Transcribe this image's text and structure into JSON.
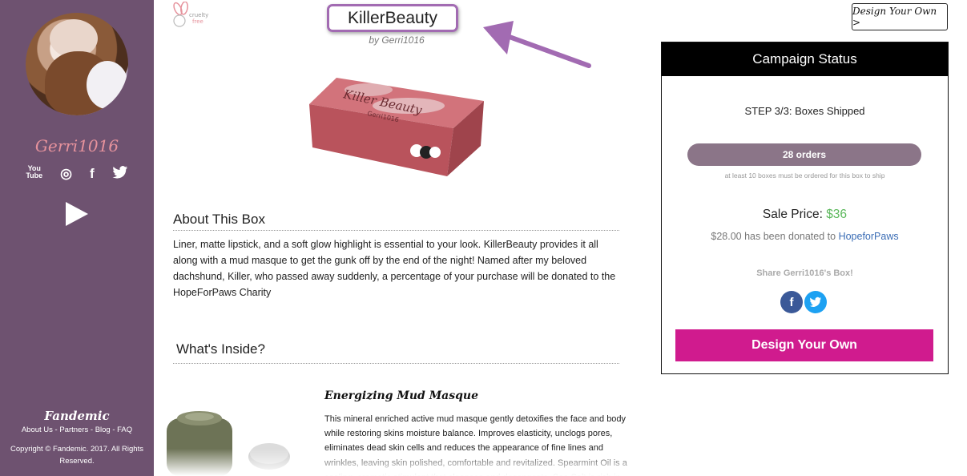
{
  "sidebar": {
    "username": "Gerri1016",
    "social_icons": [
      "youtube-icon",
      "instagram-icon",
      "facebook-icon",
      "twitter-icon"
    ],
    "social_glyphs": [
      "You\nTube",
      "◎",
      "f",
      "🐦"
    ],
    "brand": "Fandemic",
    "footer_links": "About Us - Partners - Blog - FAQ",
    "copyright": "Copyright © Fandemic. 2017. All Rights Reserved."
  },
  "header": {
    "cruelty_free": "cruelty free",
    "title": "KillerBeauty",
    "byline": "by Gerri1016",
    "design_own_top": "Design Your Own >"
  },
  "box_image": {
    "lid_text": "Killer Beauty",
    "side_text": "Gerri1016"
  },
  "about": {
    "heading": "About This Box",
    "text": "Liner, matte lipstick, and a soft glow highlight is essential to your look. KillerBeauty provides it all along with a mud masque to get the gunk off by the end of the night! Named after my beloved dachshund, Killer, who passed away suddenly, a percentage of your purchase will be donated to the HopeForPaws Charity"
  },
  "inside": {
    "heading": "What's Inside?",
    "product_name": "Energizing Mud Masque",
    "product_desc": "This mineral enriched active mud masque gently detoxifies the face and body while restoring skins moisture balance. Improves elasticity, unclogs pores, eliminates dead skin cells and reduces the appearance of fine lines and wrinkles, leaving skin polished, comfortable and revitalized. Spearmint Oil is a cooling, aromatic stimulant that cleanses and decongests. Sea Salt is rich in"
  },
  "campaign": {
    "heading": "Campaign Status",
    "step": "STEP 3/3: Boxes Shipped",
    "orders": "28 orders",
    "min_note": "at least 10 boxes must be ordered for this box to ship",
    "sale_label": "Sale Price:",
    "sale_price": "$36",
    "donated_prefix": "$28.00 has been donated to",
    "charity": "HopeforPaws",
    "share": "Share Gerri1016's Box!",
    "share_fb": "f",
    "share_tw": "t",
    "design_button": "Design Your Own"
  },
  "colors": {
    "sidebar": "#6e5270",
    "title_border": "#a26bb2",
    "arrow": "#a26bb2",
    "orders_bar": "#8b7588",
    "price": "#5cb85c",
    "design_button": "#d01b8e"
  }
}
